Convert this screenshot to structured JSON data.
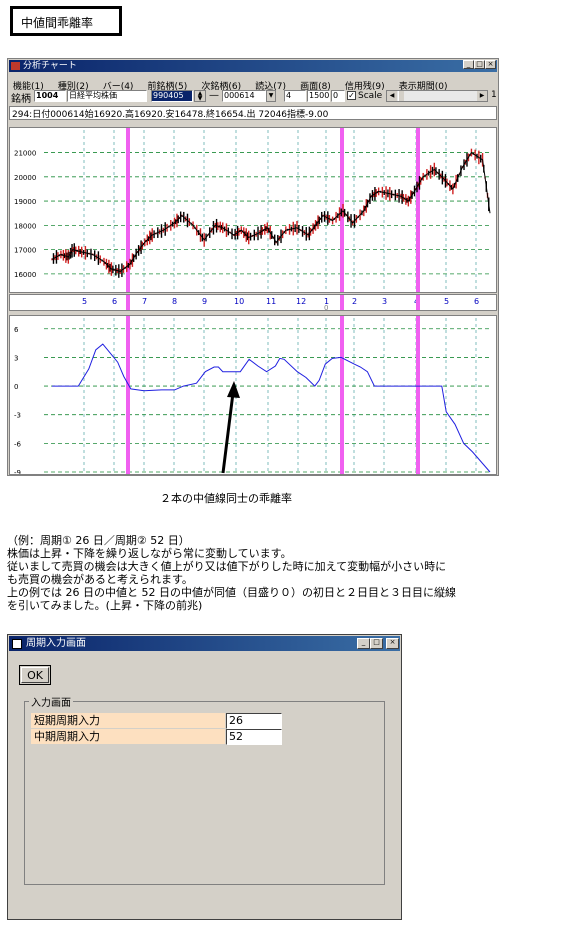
{
  "page_title": "中値間乖離率",
  "window": {
    "title": "分析チャート",
    "menu": [
      "機能(1)",
      "種別(2)",
      "バー(4)",
      "前銘柄(5)",
      "次銘柄(6)",
      "読込(7)",
      "画面(8)",
      "信用残(9)",
      "表示期間(0)"
    ],
    "toolbar": {
      "symbol_label": "銘柄",
      "code": "1004",
      "name": "日経平均株価",
      "date_from": "990405",
      "dash": "—",
      "date_to": "000614",
      "period": "4",
      "count": "1500",
      "offset": "0",
      "scale_label": "Scale",
      "scroll_value": "1"
    },
    "status": "294:日付000614始16920.高16920.安16478.終16654.出 72046指標-9.00"
  },
  "chart_data": [
    {
      "type": "line",
      "name": "price",
      "ylim": [
        15500,
        21600
      ],
      "y_ticks": [
        "21000",
        "20000",
        "19000",
        "18000",
        "17000",
        "16000"
      ],
      "x_tick_labels": [
        "5",
        "6",
        "7",
        "8",
        "9",
        "10",
        "11",
        "12",
        "1",
        "2",
        "3",
        "4",
        "5",
        "6"
      ],
      "x_sub_label": "0",
      "x": [
        0,
        12,
        22,
        28,
        40,
        55,
        70,
        80,
        92,
        105,
        115,
        125,
        135,
        150,
        165,
        175,
        190,
        205,
        220,
        230,
        245,
        255,
        265,
        280,
        290,
        302,
        315,
        330,
        345,
        355,
        365,
        378,
        392,
        405,
        420,
        430,
        440,
        455,
        470,
        480,
        490,
        500,
        515,
        528,
        540,
        553,
        565,
        580,
        590
      ],
      "y": [
        16600,
        16800,
        16700,
        17000,
        16900,
        16800,
        16500,
        16200,
        16100,
        16400,
        16900,
        17300,
        17600,
        17800,
        18100,
        18400,
        18000,
        17400,
        18000,
        17900,
        17600,
        17800,
        17500,
        17700,
        17900,
        17300,
        17800,
        17900,
        17600,
        18000,
        18400,
        18200,
        18600,
        18100,
        18600,
        19200,
        19400,
        19300,
        19200,
        19000,
        19500,
        20000,
        20300,
        19900,
        19500,
        20400,
        21000,
        20700,
        18500
      ]
    },
    {
      "type": "line",
      "name": "deviation",
      "ylim": [
        -9,
        6.5
      ],
      "y_ticks": [
        "6",
        "3",
        "0",
        "-3",
        "-6",
        "-9"
      ],
      "x": [
        0,
        30,
        42,
        50,
        58,
        66,
        75,
        82,
        90,
        105,
        125,
        140,
        150,
        165,
        175,
        185,
        190,
        195,
        205,
        215,
        225,
        235,
        245,
        255,
        260,
        265,
        280,
        290,
        300,
        305,
        312,
        320,
        330,
        345,
        352,
        360,
        368,
        376,
        385,
        395,
        410,
        420,
        430,
        445,
        450,
        460,
        470,
        480,
        500
      ],
      "y": [
        0,
        0,
        1.8,
        3.8,
        4.4,
        3.5,
        2.5,
        1,
        -0.3,
        -0.5,
        -0.4,
        -0.4,
        0,
        0.3,
        1.5,
        2,
        2,
        1.5,
        1.5,
        1.5,
        2.8,
        2.1,
        1.5,
        2.1,
        2.9,
        2.8,
        1.5,
        0.9,
        0,
        0.6,
        2.3,
        2.9,
        3,
        2.3,
        2,
        1.5,
        0,
        0,
        0,
        0,
        0,
        0,
        0,
        0,
        -2.7,
        -4,
        -6,
        -6.9,
        -9
      ]
    }
  ],
  "caption": "２本の中値線同士の乖離率",
  "paragraphs": [
    "（例：周期① 26 日／周期② 52 日）",
    "株価は上昇・下降を繰り返しながら常に変動しています。",
    "従いまして売買の機会は大きく値上がり又は値下がりした時に加えて変動幅が小さい時に",
    "も売買の機会があると考えられます。",
    "上の例では 26 日の中値と 52 日の中値が同値（目盛り０）の初日と２日目と３日目に縦線",
    "を引いてみました。(上昇・下降の前兆)"
  ],
  "dialog": {
    "title": "周期入力画面",
    "ok_label": "OK",
    "group_label": "入力画面",
    "short_label": "短期周期入力",
    "short_value": "26",
    "mid_label": "中期周期入力",
    "mid_value": "52"
  }
}
